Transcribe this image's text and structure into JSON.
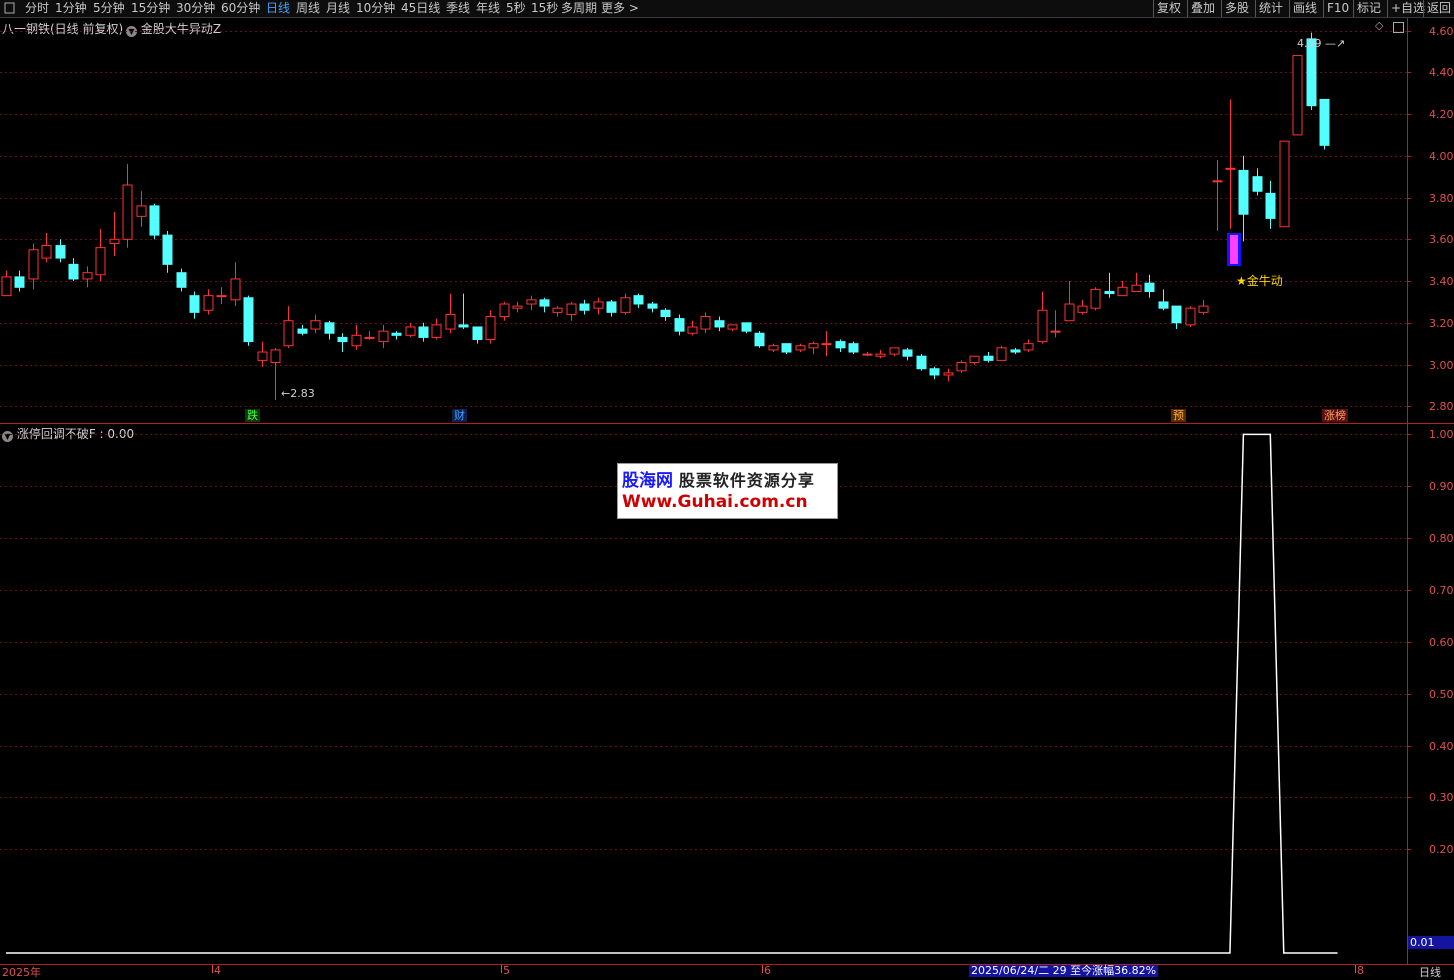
{
  "toolbar": {
    "left_items": [
      {
        "label": "分时",
        "active": false
      },
      {
        "label": "1分钟",
        "active": false
      },
      {
        "label": "5分钟",
        "active": false
      },
      {
        "label": "15分钟",
        "active": false
      },
      {
        "label": "30分钟",
        "active": false
      },
      {
        "label": "60分钟",
        "active": false
      },
      {
        "label": "日线",
        "active": true
      },
      {
        "label": "周线",
        "active": false
      },
      {
        "label": "月线",
        "active": false
      },
      {
        "label": "10分钟",
        "active": false
      },
      {
        "label": "45日线",
        "active": false
      },
      {
        "label": "季线",
        "active": false
      },
      {
        "label": "年线",
        "active": false
      },
      {
        "label": "5秒",
        "active": false
      },
      {
        "label": "15秒",
        "active": false
      },
      {
        "label": "多周期",
        "active": false
      },
      {
        "label": "更多 >",
        "active": false
      }
    ],
    "right_items": [
      "复权",
      "叠加",
      "多股",
      "统计",
      "画线",
      "F10",
      "标记",
      "+自选",
      "返回"
    ]
  },
  "main_panel": {
    "stock_title": "八一钢铁(日线 前复权)",
    "indicator_title": "金股大牛异动Z",
    "y_axis_labels": [
      "4.60",
      "4.40",
      "4.20",
      "4.00",
      "3.80",
      "3.60",
      "3.40",
      "3.20",
      "3.00",
      "2.80"
    ],
    "high_marker": "4.59",
    "low_marker": "2.83",
    "signal_label": "★金牛动",
    "badges": [
      "跌",
      "财",
      "预",
      "涨榜"
    ]
  },
  "sub_panel": {
    "title": "涨停回调不破F : 0.00",
    "y_axis_labels": [
      "1.00",
      "0.90",
      "0.80",
      "0.70",
      "0.60",
      "0.50",
      "0.40",
      "0.30",
      "0.20"
    ],
    "current_value": "0.01"
  },
  "watermark": {
    "site_name": "股海网",
    "tagline": "股票软件资源分享",
    "url": "Www.Guhai.com.cn"
  },
  "date_axis": {
    "labels": [
      "2025年",
      "4",
      "5",
      "6",
      "8"
    ],
    "status_text": "2025/06/24/二 29 至今涨幅36.82%",
    "period": "日线"
  },
  "chart_data": {
    "type": "candlestick",
    "ylim": [
      2.72,
      4.66
    ],
    "candles": [
      [
        3.33,
        3.42,
        3.45,
        3.33
      ],
      [
        3.42,
        3.37,
        3.45,
        3.35
      ],
      [
        3.41,
        3.55,
        3.58,
        3.36
      ],
      [
        3.51,
        3.57,
        3.63,
        3.49
      ],
      [
        3.57,
        3.51,
        3.6,
        3.49
      ],
      [
        3.48,
        3.41,
        3.51,
        3.4
      ],
      [
        3.41,
        3.44,
        3.47,
        3.37
      ],
      [
        3.43,
        3.56,
        3.65,
        3.4
      ],
      [
        3.58,
        3.6,
        3.73,
        3.52
      ],
      [
        3.6,
        3.86,
        3.96,
        3.56
      ],
      [
        3.71,
        3.76,
        3.83,
        3.66
      ],
      [
        3.76,
        3.62,
        3.77,
        3.6
      ],
      [
        3.62,
        3.48,
        3.64,
        3.44
      ],
      [
        3.44,
        3.37,
        3.46,
        3.35
      ],
      [
        3.33,
        3.25,
        3.35,
        3.22
      ],
      [
        3.26,
        3.33,
        3.36,
        3.24
      ],
      [
        3.33,
        3.33,
        3.37,
        3.29
      ],
      [
        3.31,
        3.41,
        3.49,
        3.28
      ],
      [
        3.32,
        3.11,
        3.33,
        3.09
      ],
      [
        3.02,
        3.06,
        3.11,
        2.99
      ],
      [
        3.01,
        3.07,
        3.08,
        2.83
      ],
      [
        3.09,
        3.21,
        3.28,
        3.08
      ],
      [
        3.17,
        3.15,
        3.19,
        3.14
      ],
      [
        3.17,
        3.21,
        3.24,
        3.15
      ],
      [
        3.2,
        3.15,
        3.21,
        3.12
      ],
      [
        3.13,
        3.11,
        3.15,
        3.06
      ],
      [
        3.09,
        3.14,
        3.19,
        3.07
      ],
      [
        3.13,
        3.13,
        3.16,
        3.12
      ],
      [
        3.11,
        3.16,
        3.19,
        3.08
      ],
      [
        3.15,
        3.14,
        3.16,
        3.12
      ],
      [
        3.14,
        3.18,
        3.2,
        3.13
      ],
      [
        3.18,
        3.13,
        3.2,
        3.11
      ],
      [
        3.13,
        3.19,
        3.22,
        3.12
      ],
      [
        3.17,
        3.24,
        3.34,
        3.15
      ],
      [
        3.19,
        3.18,
        3.34,
        3.17
      ],
      [
        3.18,
        3.12,
        3.18,
        3.1
      ],
      [
        3.12,
        3.23,
        3.26,
        3.1
      ],
      [
        3.23,
        3.29,
        3.3,
        3.21
      ],
      [
        3.27,
        3.28,
        3.3,
        3.25
      ],
      [
        3.29,
        3.31,
        3.33,
        3.26
      ],
      [
        3.31,
        3.28,
        3.32,
        3.25
      ],
      [
        3.25,
        3.27,
        3.28,
        3.23
      ],
      [
        3.24,
        3.29,
        3.3,
        3.21
      ],
      [
        3.29,
        3.26,
        3.31,
        3.24
      ],
      [
        3.27,
        3.3,
        3.32,
        3.24
      ],
      [
        3.3,
        3.25,
        3.31,
        3.23
      ],
      [
        3.25,
        3.32,
        3.34,
        3.24
      ],
      [
        3.33,
        3.29,
        3.34,
        3.27
      ],
      [
        3.29,
        3.27,
        3.3,
        3.25
      ],
      [
        3.26,
        3.23,
        3.27,
        3.21
      ],
      [
        3.22,
        3.16,
        3.24,
        3.14
      ],
      [
        3.15,
        3.18,
        3.21,
        3.14
      ],
      [
        3.17,
        3.23,
        3.25,
        3.15
      ],
      [
        3.21,
        3.18,
        3.23,
        3.16
      ],
      [
        3.17,
        3.19,
        3.19,
        3.16
      ],
      [
        3.2,
        3.16,
        3.2,
        3.15
      ],
      [
        3.15,
        3.09,
        3.16,
        3.08
      ],
      [
        3.07,
        3.09,
        3.1,
        3.06
      ],
      [
        3.1,
        3.06,
        3.1,
        3.05
      ],
      [
        3.07,
        3.09,
        3.1,
        3.06
      ],
      [
        3.08,
        3.1,
        3.11,
        3.05
      ],
      [
        3.1,
        3.1,
        3.16,
        3.04
      ],
      [
        3.11,
        3.08,
        3.12,
        3.06
      ],
      [
        3.1,
        3.06,
        3.11,
        3.05
      ],
      [
        3.05,
        3.05,
        3.06,
        3.04
      ],
      [
        3.04,
        3.05,
        3.07,
        3.03
      ],
      [
        3.05,
        3.08,
        3.08,
        3.04
      ],
      [
        3.07,
        3.04,
        3.08,
        3.02
      ],
      [
        3.04,
        2.98,
        3.05,
        2.97
      ],
      [
        2.98,
        2.95,
        2.99,
        2.93
      ],
      [
        2.95,
        2.96,
        2.98,
        2.92
      ],
      [
        2.97,
        3.01,
        3.02,
        2.96
      ],
      [
        3.01,
        3.04,
        3.04,
        3.0
      ],
      [
        3.04,
        3.02,
        3.06,
        3.01
      ],
      [
        3.02,
        3.08,
        3.09,
        3.02
      ],
      [
        3.07,
        3.06,
        3.08,
        3.05
      ],
      [
        3.07,
        3.1,
        3.12,
        3.06
      ],
      [
        3.11,
        3.26,
        3.35,
        3.1
      ],
      [
        3.16,
        3.16,
        3.26,
        3.13
      ],
      [
        3.21,
        3.29,
        3.4,
        3.21
      ],
      [
        3.25,
        3.28,
        3.31,
        3.24
      ],
      [
        3.27,
        3.36,
        3.37,
        3.26
      ],
      [
        3.35,
        3.34,
        3.44,
        3.32
      ],
      [
        3.33,
        3.37,
        3.4,
        3.33
      ],
      [
        3.35,
        3.38,
        3.44,
        3.35
      ],
      [
        3.39,
        3.35,
        3.43,
        3.32
      ],
      [
        3.3,
        3.27,
        3.36,
        3.26
      ],
      [
        3.28,
        3.2,
        3.28,
        3.17
      ],
      [
        3.19,
        3.27,
        3.28,
        3.18
      ],
      [
        3.25,
        3.28,
        3.31,
        3.24
      ],
      [
        3.88,
        3.88,
        3.98,
        3.64
      ],
      [
        3.94,
        3.94,
        4.27,
        3.65
      ],
      [
        3.93,
        3.72,
        4.0,
        3.59
      ],
      [
        3.9,
        3.83,
        3.94,
        3.81
      ],
      [
        3.82,
        3.7,
        3.88,
        3.65
      ],
      [
        3.66,
        4.07,
        4.07,
        3.66
      ],
      [
        4.1,
        4.48,
        4.48,
        4.1
      ],
      [
        4.56,
        4.24,
        4.59,
        4.22
      ],
      [
        4.27,
        4.05,
        4.27,
        4.03
      ]
    ],
    "sub_series": [
      0,
      0,
      0,
      0,
      0,
      0,
      0,
      0,
      0,
      0,
      0,
      0,
      0,
      0,
      0,
      0,
      0,
      0,
      0,
      0,
      0,
      0,
      0,
      0,
      0,
      0,
      0,
      0,
      0,
      0,
      0,
      0,
      0,
      0,
      0,
      0,
      0,
      0,
      0,
      0,
      0,
      0,
      0,
      0,
      0,
      0,
      0,
      0,
      0,
      0,
      0,
      0,
      0,
      0,
      0,
      0,
      0,
      0,
      0,
      0,
      0,
      0,
      0,
      0,
      0,
      0,
      0,
      0,
      0,
      0,
      0,
      0,
      0,
      0,
      0,
      0,
      0,
      0,
      0,
      0,
      0,
      0,
      0,
      0,
      0,
      0,
      0,
      0,
      0,
      0,
      0,
      0,
      1,
      1,
      1,
      0,
      0,
      0,
      0,
      0
    ],
    "sub_ylim": [
      0,
      1.02
    ]
  }
}
